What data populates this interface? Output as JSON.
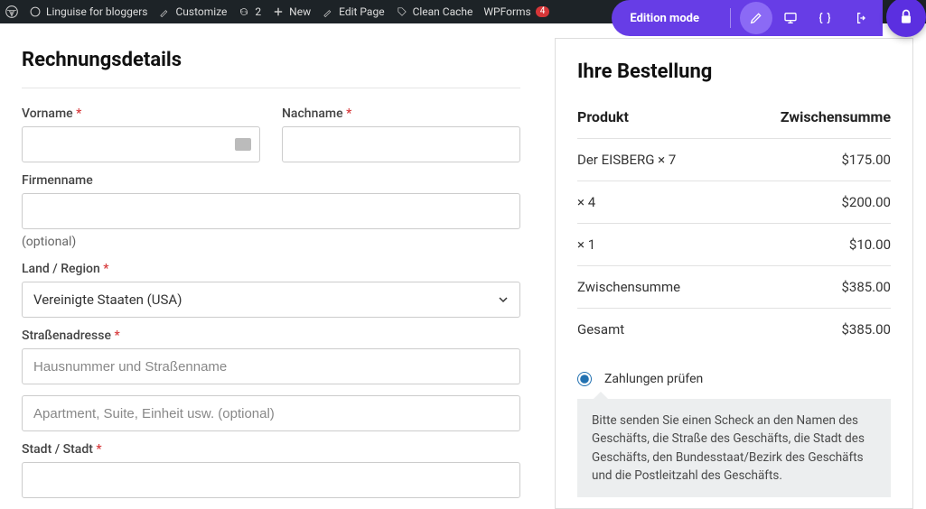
{
  "adminbar": {
    "items": [
      {
        "label": "Linguise for bloggers"
      },
      {
        "label": "Customize"
      },
      {
        "label": "2"
      },
      {
        "label": "New"
      },
      {
        "label": "Edit Page"
      },
      {
        "label": "Clean Cache"
      },
      {
        "label": "WPForms",
        "badge": "4"
      }
    ]
  },
  "edition": {
    "label": "Edition mode"
  },
  "billing": {
    "heading": "Rechnungsdetails",
    "first_name_label": "Vorname",
    "last_name_label": "Nachname",
    "company_label": "Firmenname",
    "optional_text": "(optional)",
    "country_label": "Land / Region",
    "country_value": "Vereinigte Staaten (USA)",
    "street_label": "Straßenadresse",
    "street_ph": "Hausnummer und Straßenname",
    "street2_ph": "Apartment, Suite, Einheit usw. (optional)",
    "city_label": "Stadt / Stadt"
  },
  "order": {
    "heading": "Ihre Bestellung",
    "col_product": "Produkt",
    "col_subtotal": "Zwischensumme",
    "rows": [
      {
        "name": "Der EISBERG × 7",
        "amount": "$175.00"
      },
      {
        "name": " × 4",
        "amount": "$200.00"
      },
      {
        "name": " × 1",
        "amount": "$10.00"
      }
    ],
    "subtotal_label": "Zwischensumme",
    "subtotal_value": "$385.00",
    "total_label": "Gesamt",
    "total_value": "$385.00"
  },
  "payment": {
    "check_label": "Zahlungen prüfen",
    "check_desc": "Bitte senden Sie einen Scheck an den Namen des Geschäfts, die Straße des Geschäfts, die Stadt des Geschäfts, den Bundesstaat/Bezirk des Geschäfts und die Postleitzahl des Geschäfts."
  }
}
